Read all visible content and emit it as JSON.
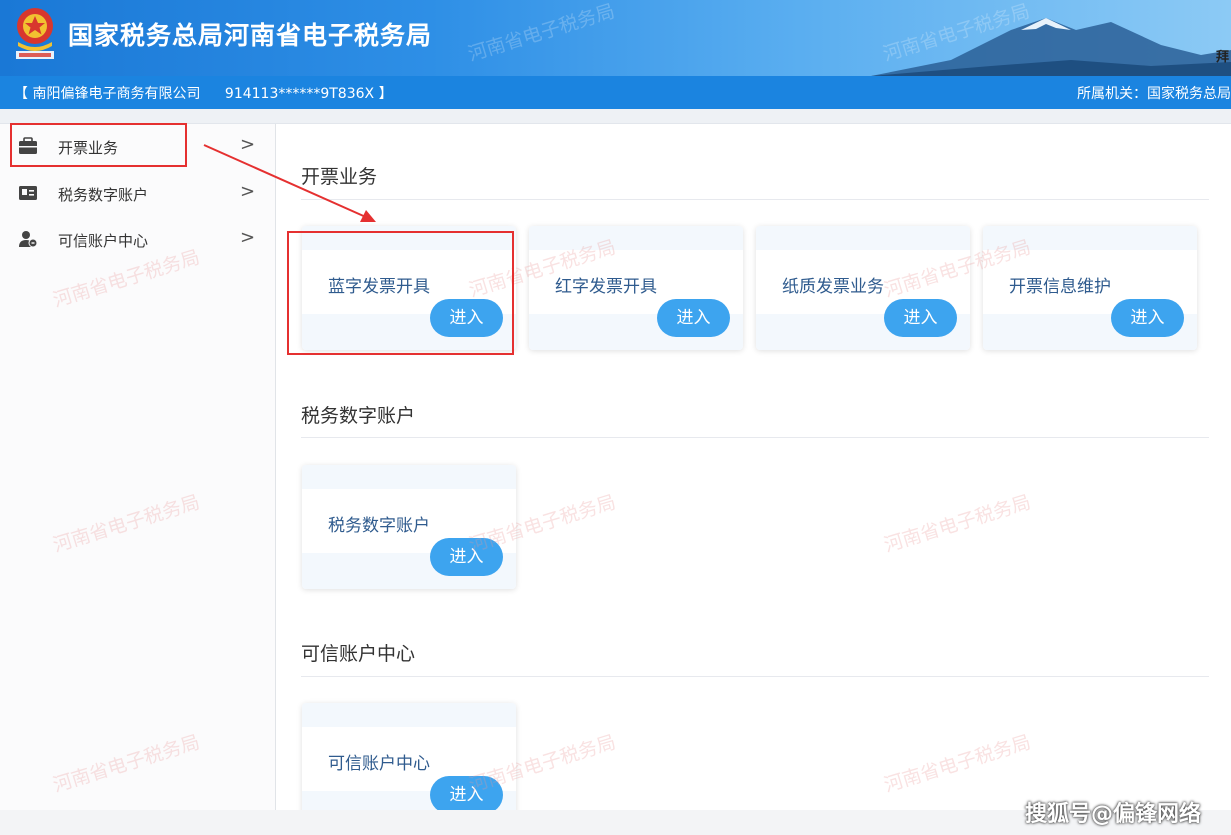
{
  "header": {
    "site_title": "国家税务总局河南省电子税务局",
    "edge_char": "拜"
  },
  "infobar": {
    "company": "【 南阳偏锋电子商务有限公司",
    "tax_id": "914113******9T836X 】",
    "authority": "所属机关：国家税务总局"
  },
  "sidebar": {
    "items": [
      {
        "label": "开票业务",
        "icon": "briefcase-icon"
      },
      {
        "label": "税务数字账户",
        "icon": "id-card-icon"
      },
      {
        "label": "可信账户中心",
        "icon": "user-shield-icon"
      }
    ],
    "chevron": ">"
  },
  "sections": [
    {
      "title": "开票业务",
      "cards": [
        {
          "label": "蓝字发票开具",
          "button": "进入"
        },
        {
          "label": "红字发票开具",
          "button": "进入"
        },
        {
          "label": "纸质发票业务",
          "button": "进入"
        },
        {
          "label": "开票信息维护",
          "button": "进入"
        }
      ]
    },
    {
      "title": "税务数字账户",
      "cards": [
        {
          "label": "税务数字账户",
          "button": "进入"
        }
      ]
    },
    {
      "title": "可信账户中心",
      "cards": [
        {
          "label": "可信账户中心",
          "button": "进入"
        }
      ]
    }
  ],
  "watermark": "河南省电子税务局",
  "sohu_mark": "搜狐号@偏锋网络",
  "colors": {
    "header_blue": "#1a78d6",
    "infobar_blue": "#1b84e0",
    "button_blue": "#3da4ef",
    "highlight_red": "#e53030",
    "card_label": "#2f5b8e"
  }
}
